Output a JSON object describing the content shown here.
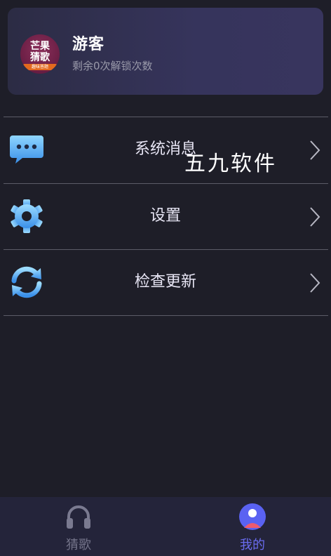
{
  "profile": {
    "avatar_line1": "芒果",
    "avatar_line2": "猜歌",
    "avatar_ribbon": "趣味答题",
    "username": "游客",
    "unlock_count": "剩余0次解锁次数"
  },
  "menu": {
    "items": [
      {
        "label": "系统消息",
        "icon": "message-icon"
      },
      {
        "label": "设置",
        "icon": "gear-icon"
      },
      {
        "label": "检查更新",
        "icon": "refresh-icon"
      }
    ]
  },
  "watermark": "五九软件",
  "bottom_nav": {
    "items": [
      {
        "label": "猜歌",
        "icon": "headphones-icon",
        "active": false
      },
      {
        "label": "我的",
        "icon": "user-icon",
        "active": true
      }
    ]
  },
  "colors": {
    "background": "#1e1e28",
    "active_tab": "#6a6cf0",
    "inactive_tab": "#74748a",
    "icon_blue": "#5ab4ff"
  }
}
